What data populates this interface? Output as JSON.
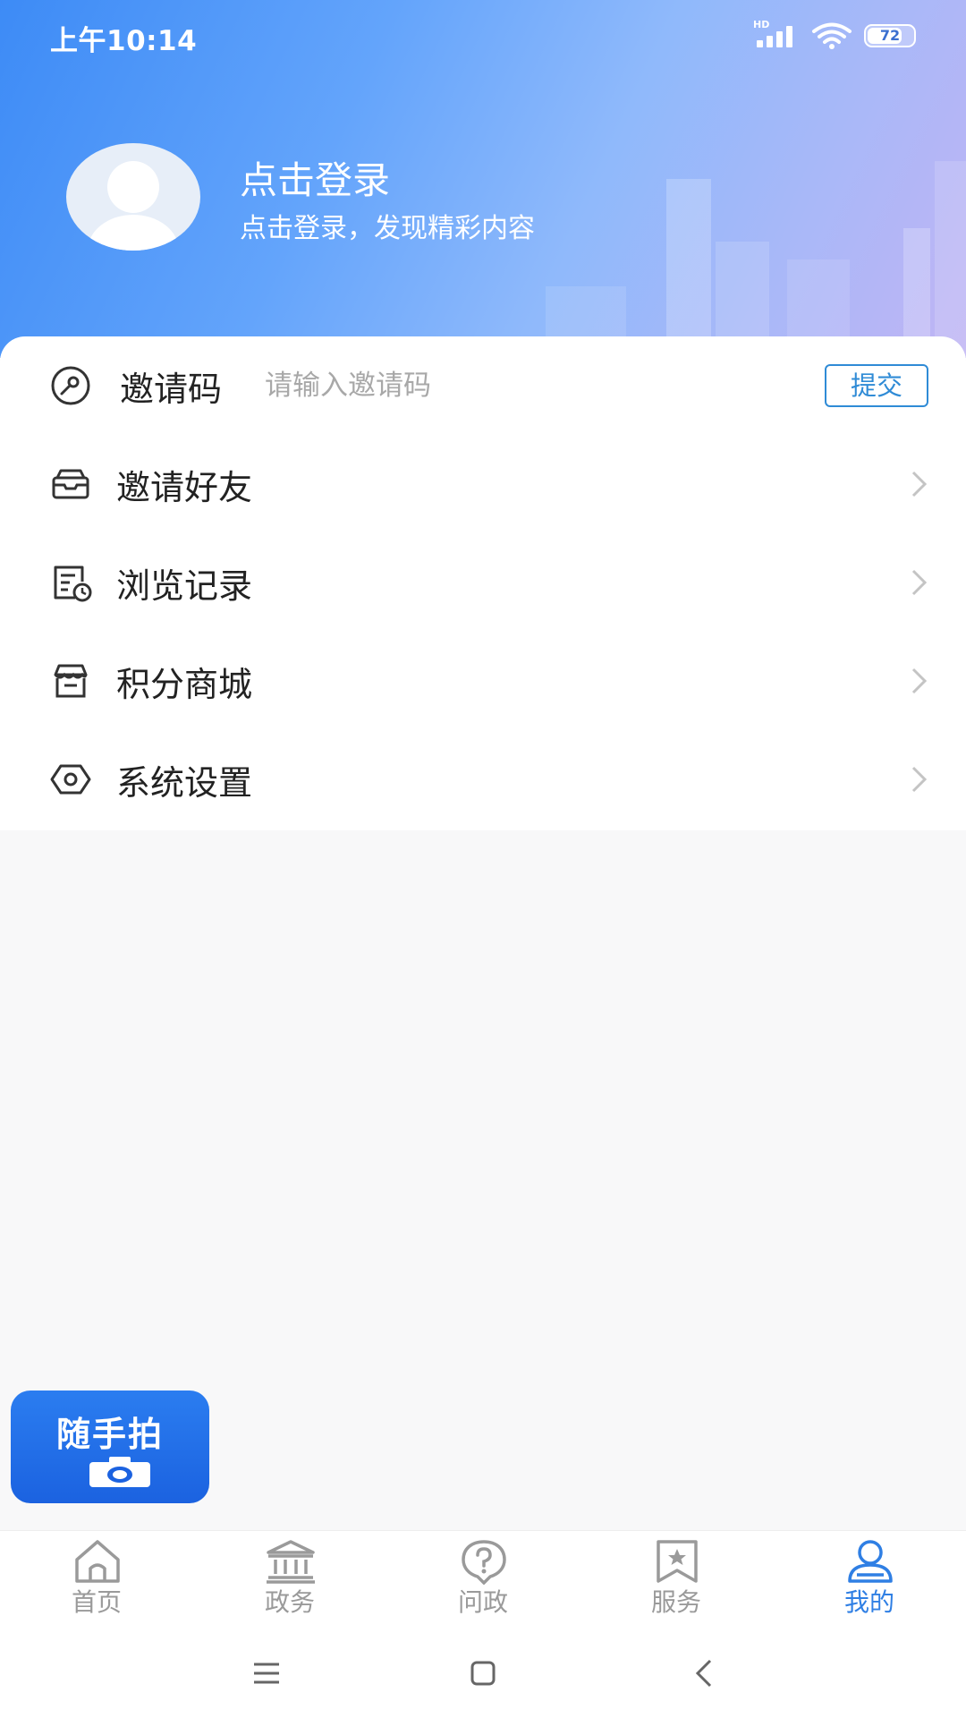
{
  "status_bar": {
    "time": "上午10:14",
    "network": "HD",
    "battery": "72"
  },
  "profile": {
    "title": "点击登录",
    "subtitle": "点击登录，发现精彩内容"
  },
  "invite": {
    "label": "邀请码",
    "placeholder": "请输入邀请码",
    "submit_label": "提交"
  },
  "menu": {
    "items": [
      {
        "label": "邀请好友",
        "icon": "mailbox-icon"
      },
      {
        "label": "浏览记录",
        "icon": "history-icon"
      },
      {
        "label": "积分商城",
        "icon": "shop-icon"
      },
      {
        "label": "系统设置",
        "icon": "settings-icon"
      }
    ]
  },
  "fab": {
    "label": "随手拍",
    "icon": "camera-icon"
  },
  "tabbar": {
    "items": [
      {
        "label": "首页",
        "icon": "home-icon"
      },
      {
        "label": "政务",
        "icon": "government-icon"
      },
      {
        "label": "问政",
        "icon": "question-icon"
      },
      {
        "label": "服务",
        "icon": "service-icon"
      },
      {
        "label": "我的",
        "icon": "user-icon"
      }
    ],
    "active_index": 4
  },
  "colors": {
    "accent": "#2f7fe4",
    "header_start": "#3d8bf6",
    "header_end": "#c0b4f4",
    "inactive_tab": "#9a9a9a"
  }
}
